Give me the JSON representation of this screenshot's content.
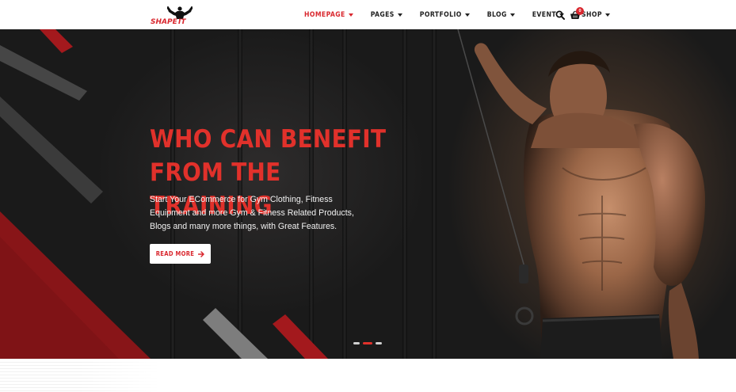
{
  "logo": {
    "text": "SHAPE IT",
    "icon": "bodybuilder-logo"
  },
  "nav": {
    "items": [
      {
        "label": "HOMEPAGE",
        "active": true
      },
      {
        "label": "PAGES",
        "active": false
      },
      {
        "label": "PORTFOLIO",
        "active": false
      },
      {
        "label": "BLOG",
        "active": false
      },
      {
        "label": "EVENT",
        "active": false
      },
      {
        "label": "SHOP",
        "active": false
      }
    ],
    "search_icon": "search-icon",
    "cart_icon": "basket-icon",
    "cart_count": "0"
  },
  "hero": {
    "title_line1": "WHO CAN BENEFIT",
    "title_line2": "FROM THE TRAINING",
    "description": "Start Your ECommerce for Gym Clothing, Fitness Equipment and more Gym & Fitness Related Products, Blogs and many more things, with Great Features.",
    "button_label": "READ MORE",
    "slides": 3,
    "active_slide": 2
  },
  "colors": {
    "accent": "#d9272e",
    "dark": "#1a1a1a",
    "stripe_gray": "#5a5a5a",
    "stripe_red": "#8e1518"
  }
}
